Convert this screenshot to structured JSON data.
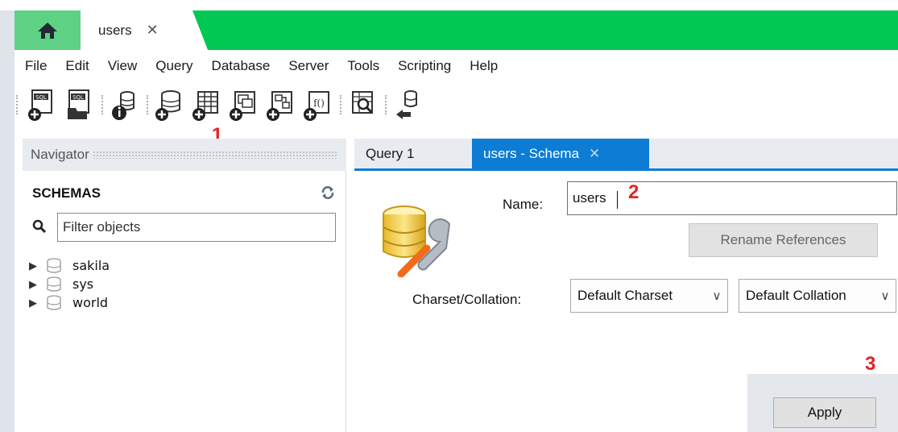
{
  "tabs": {
    "home_icon": "home-icon",
    "document_tab": {
      "label": "users",
      "close": "✕"
    }
  },
  "menu": [
    "File",
    "Edit",
    "View",
    "Query",
    "Database",
    "Server",
    "Tools",
    "Scripting",
    "Help"
  ],
  "toolbar": {
    "icons": [
      "new-sql-tab-icon",
      "open-sql-script-icon",
      "schema-inspector-icon",
      "create-schema-icon",
      "create-table-icon",
      "create-view-icon",
      "create-procedure-icon",
      "create-function-icon",
      "search-table-data-icon",
      "reconnect-icon"
    ]
  },
  "annotations": {
    "one": "1",
    "two": "2",
    "three": "3"
  },
  "navigator": {
    "title": "Navigator",
    "schemas_label": "SCHEMAS",
    "filter_placeholder": "Filter objects",
    "schemas": [
      "sakila",
      "sys",
      "world"
    ]
  },
  "editor_tabs": [
    {
      "label": "Query 1"
    },
    {
      "label": "users - Schema",
      "close": "✕"
    }
  ],
  "schema_editor": {
    "name_label": "Name:",
    "name_value": "users",
    "rename_button": "Rename References",
    "charset_label": "Charset/Collation:",
    "charset_value": "Default Charset",
    "collation_value": "Default Collation",
    "apply_button": "Apply"
  },
  "colors": {
    "accent_green": "#00c853",
    "tab_blue": "#0c7cd5",
    "annotation_red": "#e02424"
  }
}
